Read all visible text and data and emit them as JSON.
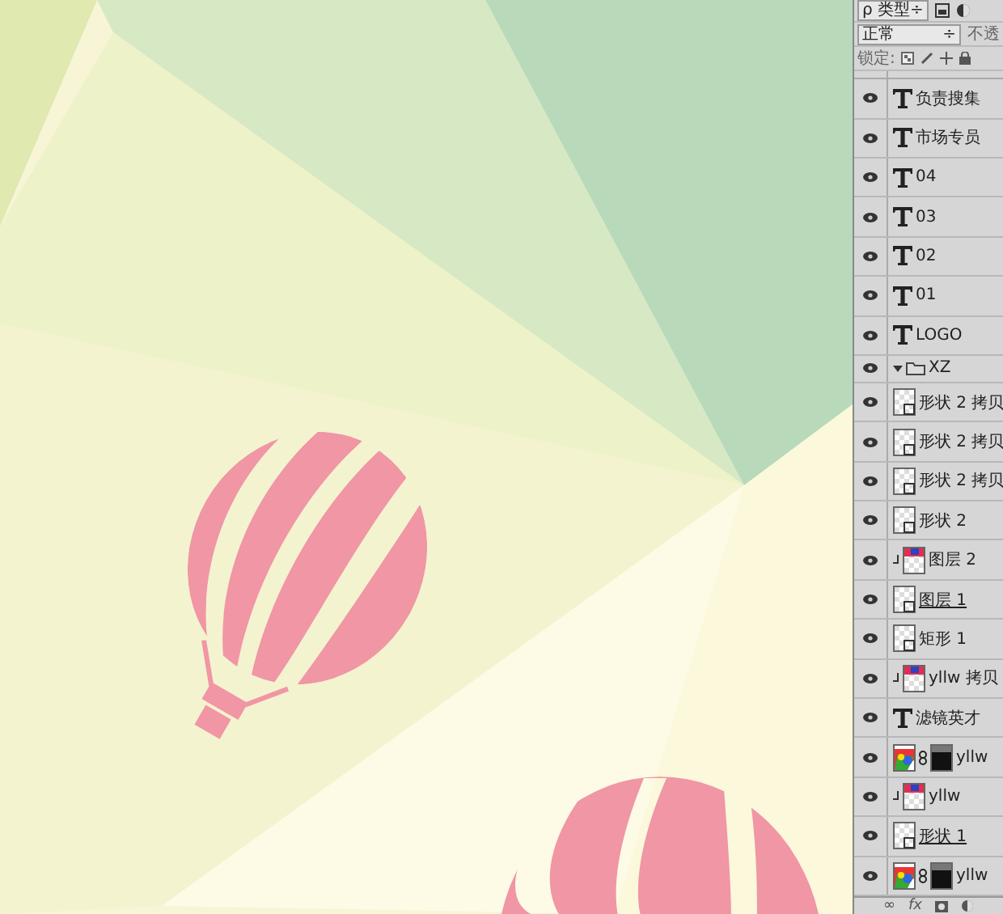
{
  "layers_panel": {
    "filter": {
      "value": "ρ 类型",
      "arrow": "÷"
    },
    "blend_mode": {
      "value": "正常",
      "arrow": "÷"
    },
    "opacity_label": "不透",
    "footer": {
      "link": "∞",
      "fx": "fx"
    },
    "lock_label": "锁定:",
    "layers": [
      {
        "kind": "text",
        "name": "负责搜集",
        "visible": true,
        "clipped": false,
        "underlined": false
      },
      {
        "kind": "text",
        "name": "市场专员",
        "visible": true,
        "clipped": false,
        "underlined": false
      },
      {
        "kind": "text",
        "name": "04",
        "visible": true,
        "clipped": false,
        "underlined": false
      },
      {
        "kind": "text",
        "name": "03",
        "visible": true,
        "clipped": false,
        "underlined": false
      },
      {
        "kind": "text",
        "name": "02",
        "visible": true,
        "clipped": false,
        "underlined": false
      },
      {
        "kind": "text",
        "name": "01",
        "visible": true,
        "clipped": false,
        "underlined": false
      },
      {
        "kind": "text",
        "name": "LOGO",
        "visible": true,
        "clipped": false,
        "underlined": false
      },
      {
        "kind": "group",
        "name": "XZ",
        "visible": true,
        "expanded": true,
        "clipped": false,
        "underlined": false
      },
      {
        "kind": "shape",
        "name": "形状 2 拷贝",
        "visible": true,
        "clipped": false,
        "underlined": false
      },
      {
        "kind": "shape",
        "name": "形状 2 拷贝",
        "visible": true,
        "clipped": false,
        "underlined": false
      },
      {
        "kind": "shape",
        "name": "形状 2 拷贝",
        "visible": true,
        "clipped": false,
        "underlined": false
      },
      {
        "kind": "shape",
        "name": "形状 2",
        "visible": true,
        "clipped": false,
        "underlined": false
      },
      {
        "kind": "image",
        "name": "图层 2",
        "visible": true,
        "clipped": true,
        "underlined": false
      },
      {
        "kind": "shape",
        "name": "图层 1",
        "visible": true,
        "clipped": false,
        "underlined": true
      },
      {
        "kind": "shape",
        "name": "矩形 1",
        "visible": true,
        "clipped": false,
        "underlined": false
      },
      {
        "kind": "image",
        "name": "yllw 拷贝",
        "visible": true,
        "clipped": true,
        "underlined": false
      },
      {
        "kind": "text",
        "name": "滤镜英才",
        "visible": true,
        "clipped": false,
        "underlined": false
      },
      {
        "kind": "mask",
        "name": "yllw",
        "visible": true,
        "clipped": false,
        "underlined": false
      },
      {
        "kind": "image",
        "name": "yllw",
        "visible": true,
        "clipped": true,
        "underlined": false
      },
      {
        "kind": "shape",
        "name": "形状 1",
        "visible": true,
        "clipped": false,
        "underlined": true
      },
      {
        "kind": "mask",
        "name": "yllw",
        "visible": true,
        "clipped": false,
        "underlined": false
      }
    ]
  }
}
